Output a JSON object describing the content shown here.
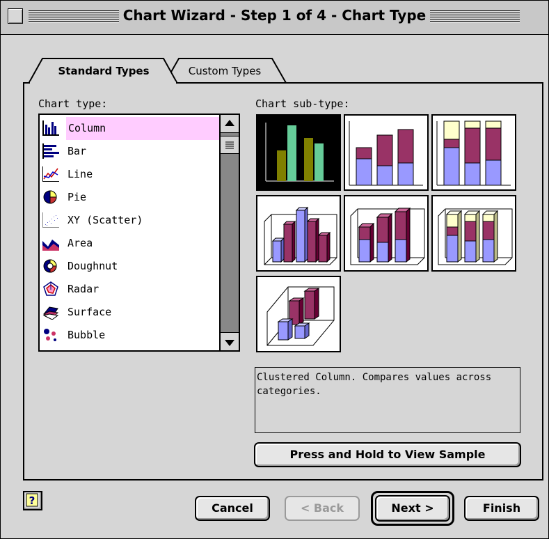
{
  "window": {
    "title": "Chart Wizard - Step 1 of 4 - Chart Type"
  },
  "tabs": [
    {
      "label": "Standard Types",
      "active": true
    },
    {
      "label": "Custom Types",
      "active": false
    }
  ],
  "chart_type": {
    "label": "Chart type:",
    "items": [
      {
        "label": "Column",
        "icon": "column-chart-icon",
        "selected": true
      },
      {
        "label": "Bar",
        "icon": "bar-chart-icon"
      },
      {
        "label": "Line",
        "icon": "line-chart-icon"
      },
      {
        "label": "Pie",
        "icon": "pie-chart-icon"
      },
      {
        "label": "XY (Scatter)",
        "icon": "scatter-chart-icon"
      },
      {
        "label": "Area",
        "icon": "area-chart-icon"
      },
      {
        "label": "Doughnut",
        "icon": "doughnut-chart-icon"
      },
      {
        "label": "Radar",
        "icon": "radar-chart-icon"
      },
      {
        "label": "Surface",
        "icon": "surface-chart-icon"
      },
      {
        "label": "Bubble",
        "icon": "bubble-chart-icon"
      }
    ]
  },
  "sub_type": {
    "label": "Chart sub-type:",
    "description": "Clustered Column. Compares values across categories.",
    "selected_index": 0
  },
  "buttons": {
    "view_sample": "Press and Hold to View Sample",
    "cancel": "Cancel",
    "back": "< Back",
    "next": "Next >",
    "finish": "Finish"
  },
  "colors": {
    "selection_highlight": "#ffccff",
    "series_blue": "#9999ff",
    "series_maroon": "#993366",
    "series_cream": "#ffffcc",
    "series_olive": "#808000",
    "series_mint": "#66cc99"
  }
}
